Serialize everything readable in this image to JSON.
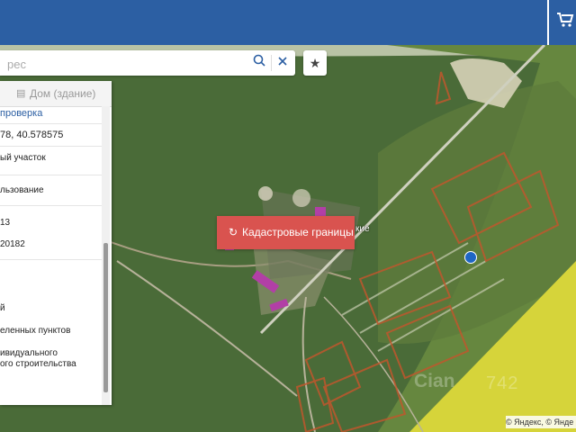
{
  "search": {
    "placeholder": "рес",
    "search_icon": "search-icon",
    "clear_icon": "close-icon",
    "favorite_icon": "star-icon"
  },
  "header": {
    "cart_icon": "cart-icon"
  },
  "panel": {
    "tab_label": "Дом (здание)",
    "tab_icon": "building-icon",
    "rows": [
      "проверка",
      "78, 40.578575",
      "ый участок",
      "льзование",
      "13",
      "20182",
      "й",
      "еленных пунктов",
      "ивидуального",
      "ого строительства"
    ]
  },
  "map": {
    "cadastral_button_label": "Кадастровые границы",
    "cadastral_button_icon": "refresh-icon",
    "place_label": "кие",
    "attribution": "© Яндекс, © Янде",
    "watermark": "Cian",
    "watermark_number": "742"
  },
  "colors": {
    "header": "#2c5fa3",
    "accent_button": "#d9534f",
    "field_yellow": "#d6d43a",
    "cadastral_outline": "#c0572d"
  }
}
